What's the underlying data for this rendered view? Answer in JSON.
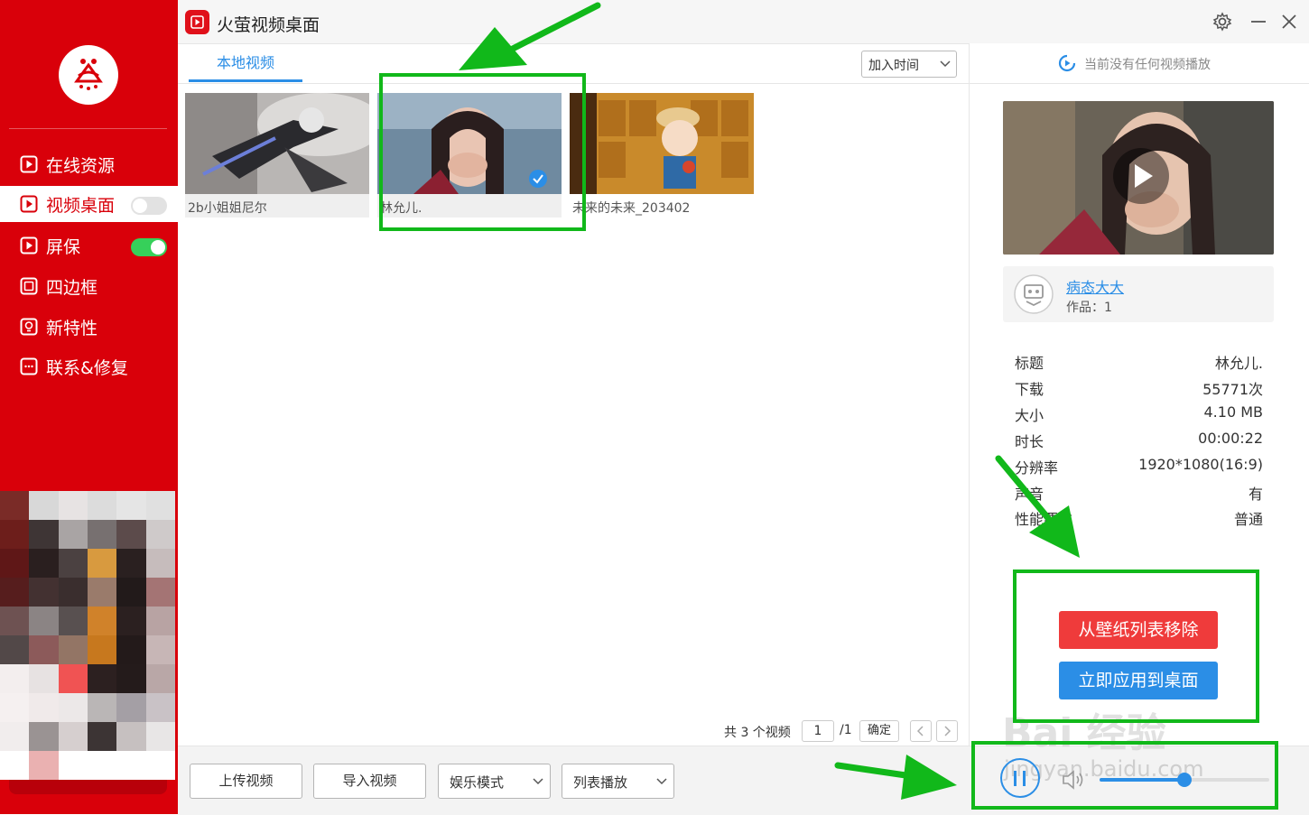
{
  "app": {
    "title": "火萤视频桌面"
  },
  "sidebar": {
    "items": [
      {
        "label": "在线资源",
        "icon": "play-square-icon"
      },
      {
        "label": "视频桌面",
        "icon": "play-square-icon",
        "active": true,
        "toggle": "off"
      },
      {
        "label": "屏保",
        "icon": "play-square-icon",
        "toggle": "on"
      },
      {
        "label": "四边框",
        "icon": "square-icon"
      },
      {
        "label": "新特性",
        "icon": "lightbulb-icon"
      },
      {
        "label": "联系&修复",
        "icon": "chat-icon"
      }
    ]
  },
  "tabs": {
    "local": "本地视频"
  },
  "sort": {
    "value": "加入时间"
  },
  "videos": [
    {
      "label": "2b小姐姐尼尔",
      "selected": false
    },
    {
      "label": "林允儿.",
      "selected": true
    },
    {
      "label": "未来的未来_203402",
      "selected": false
    }
  ],
  "pager": {
    "total": "共 3 个视频",
    "page": "1",
    "of": "/1",
    "confirm": "确定"
  },
  "bottom": {
    "upload": "上传视频",
    "import": "导入视频",
    "mode": "娱乐模式",
    "playback": "列表播放"
  },
  "right": {
    "status": "当前没有任何视频播放",
    "author": {
      "name": "病态大大",
      "works": "作品：1"
    },
    "info": [
      {
        "key": "标题",
        "value": "林允儿."
      },
      {
        "key": "下载",
        "value": "55771次"
      },
      {
        "key": "大小",
        "value": "4.10 MB"
      },
      {
        "key": "时长",
        "value": "00:00:22"
      },
      {
        "key": "分辨率",
        "value": "1920*1080(16:9)"
      },
      {
        "key": "声音",
        "value": "有"
      },
      {
        "key": "性能要求",
        "value": "普通"
      }
    ],
    "remove_button": "从壁纸列表移除",
    "apply_button": "立即应用到桌面"
  },
  "player": {
    "volume": 0.5
  },
  "watermark": {
    "main": "Bai 经验",
    "url": "jingyan.baidu.com"
  },
  "colors": {
    "brand_red": "#d9000a",
    "accent_blue": "#2b8ee6",
    "remove_red": "#ef3b3b",
    "toggle_green": "#36d05a",
    "highlight_green": "#11b81a"
  }
}
